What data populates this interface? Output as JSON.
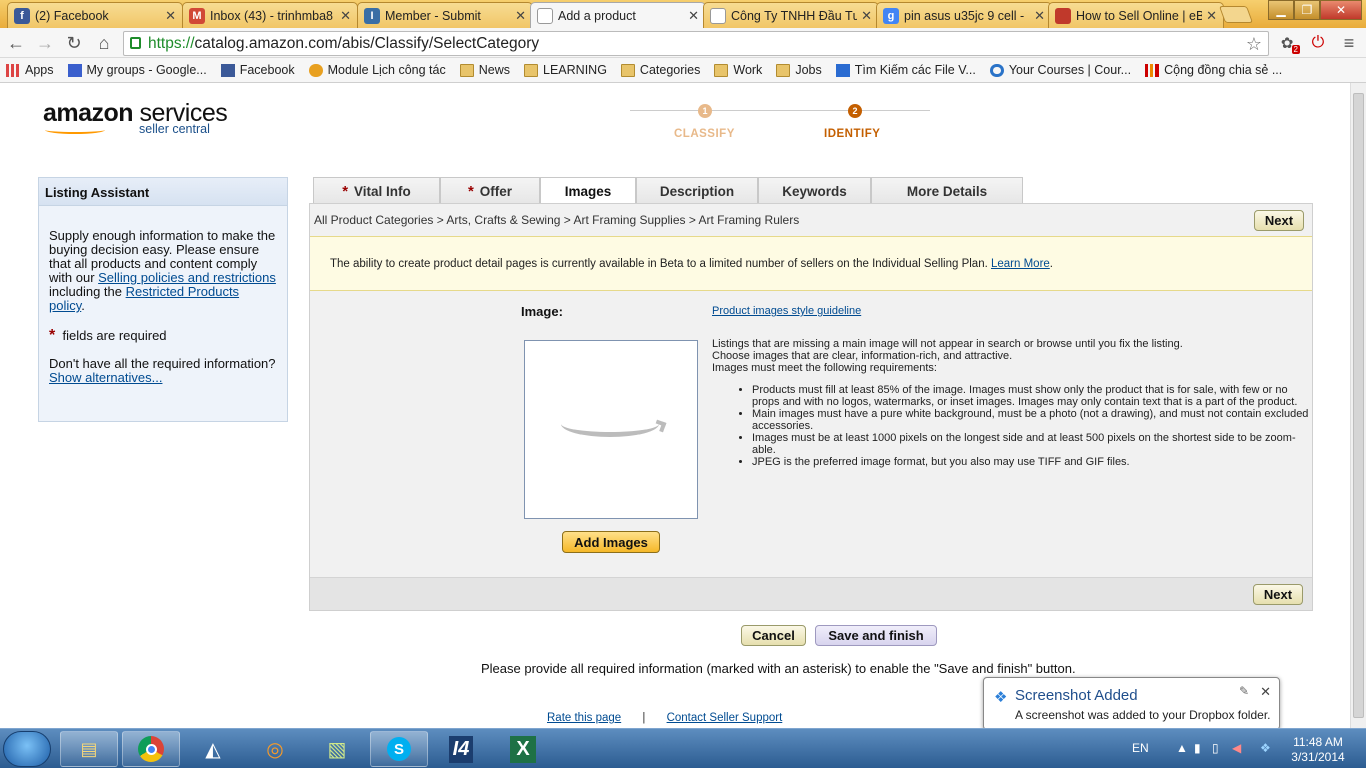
{
  "browser": {
    "tabs": [
      {
        "label": "(2) Facebook",
        "icon": "f",
        "icon_color": "#3b5998"
      },
      {
        "label": "Inbox (43) - trinhmba8",
        "icon": "M",
        "icon_color": "#d14836"
      },
      {
        "label": "Member - Submit",
        "icon": "I",
        "icon_color": "#3a6ea5"
      },
      {
        "label": "Add a product",
        "icon": "",
        "icon_color": "#ffffff"
      },
      {
        "label": "Công Ty TNHH Đầu Tư",
        "icon": "",
        "icon_color": "#ffffff"
      },
      {
        "label": "pin asus u35jc 9 cell -",
        "icon": "g",
        "icon_color": "#4285f4"
      },
      {
        "label": "How to Sell Online | eB",
        "icon": "",
        "icon_color": "#c0392b"
      }
    ],
    "url_scheme": "https://",
    "url_rest": "catalog.amazon.com/abis/Classify/SelectCategory",
    "ext_badge": "2",
    "bookmarks": [
      {
        "label": "Apps"
      },
      {
        "label": "My groups - Google..."
      },
      {
        "label": "Facebook"
      },
      {
        "label": "Module Lịch công tác"
      },
      {
        "label": "News"
      },
      {
        "label": "LEARNING"
      },
      {
        "label": "Categories"
      },
      {
        "label": "Work"
      },
      {
        "label": "Jobs"
      },
      {
        "label": "Tìm Kiếm các File V..."
      },
      {
        "label": "Your Courses | Cour..."
      },
      {
        "label": "Cộng đồng chia sẻ ..."
      }
    ]
  },
  "header": {
    "logo_bold": "amazon",
    "logo_rest": " services",
    "logo_sub": "seller central",
    "steps": [
      {
        "num": "1",
        "label": "CLASSIFY",
        "color": "#e8b98a"
      },
      {
        "num": "2",
        "label": "IDENTIFY",
        "color": "#c45f00"
      }
    ]
  },
  "assistant": {
    "title": "Listing Assistant",
    "p1_a": "Supply enough information to make the buying decision easy. Please ensure that all products and content comply with our ",
    "link1": "Selling policies and restrictions",
    "p1_b": " including the ",
    "link2": "Restricted Products policy",
    "p1_c": ".",
    "asterisk": "*",
    "required": "fields are required",
    "p2": "Don't have all the required information?",
    "link3": "Show alternatives..."
  },
  "tabs": [
    {
      "label": "Vital Info",
      "required": "*"
    },
    {
      "label": "Offer",
      "required": "*"
    },
    {
      "label": "Images",
      "required": ""
    },
    {
      "label": "Description",
      "required": ""
    },
    {
      "label": "Keywords",
      "required": ""
    },
    {
      "label": "More Details",
      "required": ""
    }
  ],
  "main": {
    "breadcrumb": "All Product Categories > Arts, Crafts & Sewing > Art Framing Supplies > Art Framing Rulers",
    "next_label": "Next",
    "beta_text": "The ability to create product detail pages is currently available in Beta to a limited number of sellers on the Individual Selling Plan. ",
    "beta_link": "Learn More",
    "beta_end": ".",
    "image_label": "Image:",
    "guideline_link": "Product images style guideline",
    "intro_lines": [
      "Listings that are missing a main image will not appear in search or browse until you fix the listing.",
      "Choose images that are clear, information-rich, and attractive.",
      "Images must meet the following requirements:"
    ],
    "requirements": [
      "Products must fill at least 85% of the image. Images must show only the product that is for sale, with few or no props and with no logos, watermarks, or inset images. Images may only contain text that is a part of the product.",
      "Main images must have a pure white background, must be a photo (not a drawing), and must not contain excluded accessories.",
      "Images must be at least 1000 pixels on the longest side and at least 500 pixels on the shortest side to be zoom-able.",
      "JPEG is the preferred image format, but you also may use TIFF and GIF files."
    ],
    "add_images": "Add Images",
    "cancel": "Cancel",
    "save_finish": "Save and finish",
    "note": "Please provide all required information (marked with an asterisk) to enable the \"Save and finish\" button.",
    "rate": "Rate this page",
    "sep": "|",
    "contact": "Contact Seller Support"
  },
  "toast": {
    "title": "Screenshot Added",
    "body": "A screenshot was added to your Dropbox folder."
  },
  "taskbar": {
    "lang": "EN",
    "time": "11:48 AM",
    "date": "3/31/2014"
  }
}
